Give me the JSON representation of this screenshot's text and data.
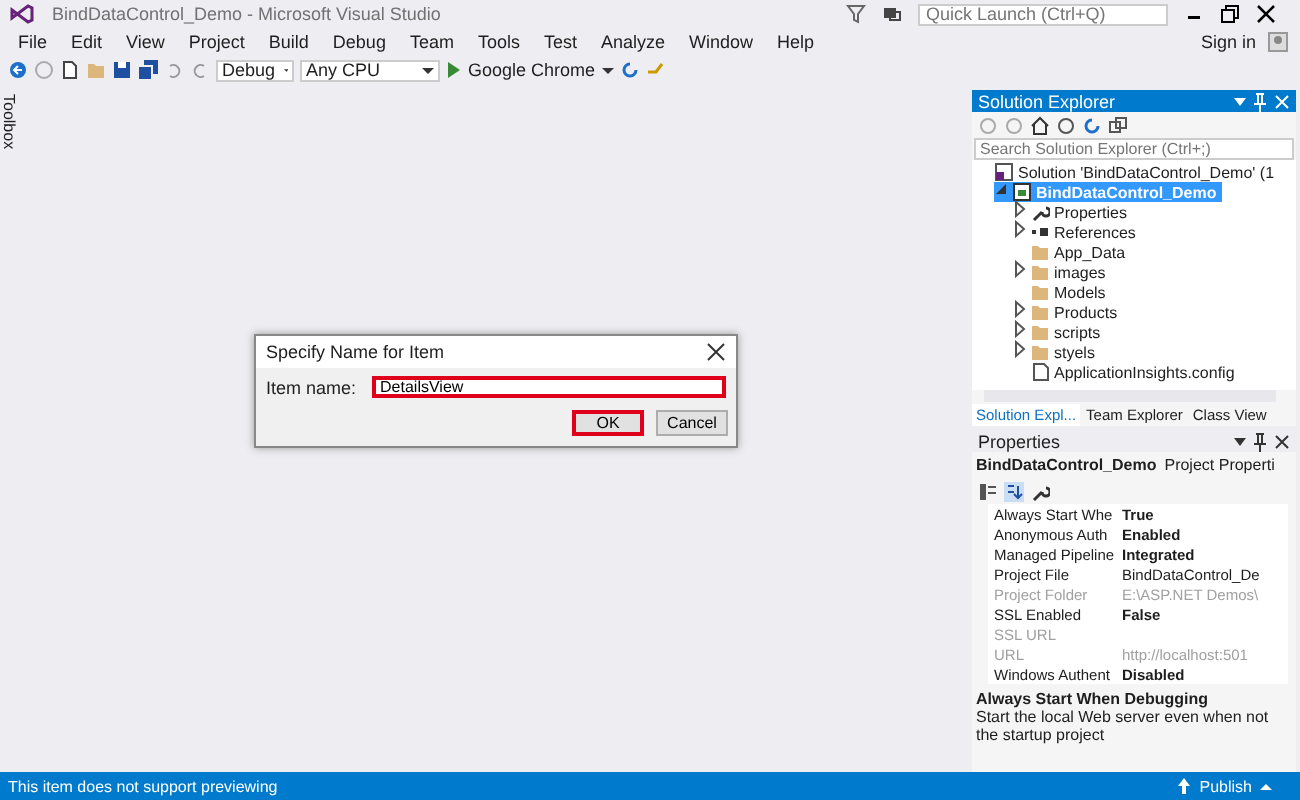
{
  "window": {
    "title": "BindDataControl_Demo - Microsoft Visual Studio"
  },
  "quick_launch": {
    "placeholder": "Quick Launch (Ctrl+Q)"
  },
  "menu": [
    "File",
    "Edit",
    "View",
    "Project",
    "Build",
    "Debug",
    "Team",
    "Tools",
    "Test",
    "Analyze",
    "Window",
    "Help"
  ],
  "sign_in": "Sign in",
  "toolbar": {
    "configuration": "Debug",
    "platform": "Any CPU",
    "browser": "Google Chrome"
  },
  "toolbox": "Toolbox",
  "dialog": {
    "title": "Specify Name for Item",
    "label": "Item name:",
    "value": "DetailsView",
    "buttons": [
      {
        "label": "OK",
        "default": true
      },
      {
        "label": "Cancel",
        "default": false
      }
    ]
  },
  "solution_explorer": {
    "title": "Solution Explorer",
    "search": {
      "placeholder": "Search Solution Explorer (Ctrl+;)"
    },
    "tree": [
      {
        "label": "Solution 'BindDataControl_Demo' (1",
        "kind": "solution",
        "selected": false,
        "children": [
          {
            "label": "BindDataControl_Demo",
            "kind": "project",
            "selected": true,
            "expanded": true,
            "children": [
              {
                "label": "Properties",
                "kind": "wrench",
                "selected": false,
                "expanded": false
              },
              {
                "label": "References",
                "kind": "references",
                "selected": false,
                "expanded": false
              },
              {
                "label": "App_Data",
                "kind": "folder",
                "selected": false
              },
              {
                "label": "images",
                "kind": "folder",
                "selected": false,
                "expanded": false
              },
              {
                "label": "Models",
                "kind": "folder",
                "selected": false
              },
              {
                "label": "Products",
                "kind": "folder",
                "selected": false,
                "expanded": false
              },
              {
                "label": "scripts",
                "kind": "folder",
                "selected": false,
                "expanded": false
              },
              {
                "label": "styels",
                "kind": "folder",
                "selected": false,
                "expanded": false
              },
              {
                "label": "ApplicationInsights.config",
                "kind": "config",
                "selected": false
              }
            ]
          }
        ]
      }
    ],
    "tabs": [
      {
        "label": "Solution Expl...",
        "selected": true
      },
      {
        "label": "Team Explorer",
        "selected": false
      },
      {
        "label": "Class View",
        "selected": false
      }
    ]
  },
  "properties": {
    "title": "Properties",
    "object": "BindDataControl_Demo",
    "object_type": "Project Properti",
    "rows": [
      {
        "name": "Always Start Whe",
        "value": "True",
        "bold": true,
        "disabled": false
      },
      {
        "name": "Anonymous Auth",
        "value": "Enabled",
        "bold": true,
        "disabled": false
      },
      {
        "name": "Managed Pipeline",
        "value": "Integrated",
        "bold": true,
        "disabled": false
      },
      {
        "name": "Project File",
        "value": "BindDataControl_De",
        "bold": false,
        "disabled": false
      },
      {
        "name": "Project Folder",
        "value": "E:\\ASP.NET Demos\\",
        "bold": false,
        "disabled": true
      },
      {
        "name": "SSL Enabled",
        "value": "False",
        "bold": true,
        "disabled": false
      },
      {
        "name": "SSL URL",
        "disabled": true
      },
      {
        "name": "URL",
        "value": "http://localhost:501",
        "bold": false,
        "disabled": true
      },
      {
        "name": "Windows Authent",
        "value": "Disabled",
        "bold": true,
        "disabled": false
      }
    ],
    "description_title": "Always Start When Debugging",
    "description": "Start the local Web server even when not the startup project"
  },
  "status_bar": {
    "message": "This item does not support previewing",
    "publish": "Publish"
  }
}
